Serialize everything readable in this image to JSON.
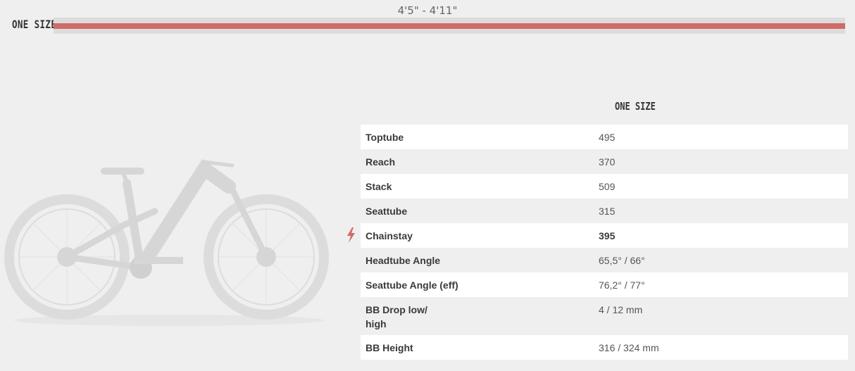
{
  "size_selector": {
    "range_label": "4'5\" - 4'11\"",
    "size_name": "ONE SIZE",
    "fill_fraction": 1.0,
    "accent_color": "#d06a66"
  },
  "geometry": {
    "column_header": "ONE SIZE",
    "highlight_icon": "lightning-bolt-icon",
    "rows": [
      {
        "name": "Toptube",
        "value": "495"
      },
      {
        "name": "Reach",
        "value": "370"
      },
      {
        "name": "Stack",
        "value": "509"
      },
      {
        "name": "Seattube",
        "value": "315"
      },
      {
        "name": "Chainstay",
        "value": "395"
      },
      {
        "name": "Headtube Angle",
        "value": "65,5° / 66°"
      },
      {
        "name": "Seattube Angle (eff)",
        "value": "76,2° / 77°"
      },
      {
        "name": "BB Drop low/ high",
        "value": "4 / 12 mm"
      },
      {
        "name": "BB Height",
        "value": "316 / 324 mm"
      }
    ]
  }
}
